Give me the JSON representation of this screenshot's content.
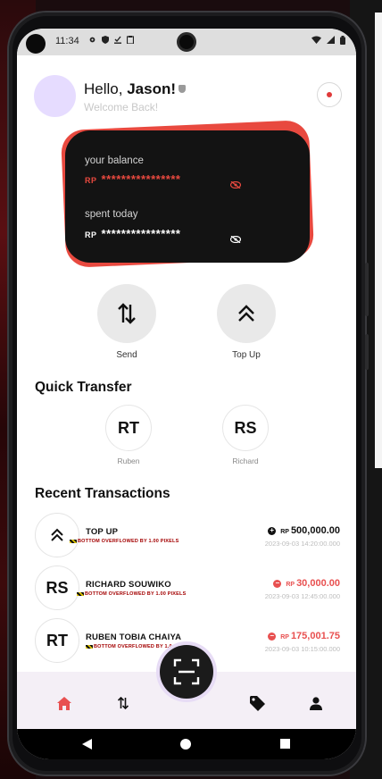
{
  "status": {
    "time": "11:34"
  },
  "header": {
    "greeting": "Hello,",
    "name": "Jason!",
    "subtitle": "Welcome Back!"
  },
  "balance_card": {
    "balance_label": "your balance",
    "balance_currency": "RP",
    "balance_value": "****************",
    "spent_label": "spent today",
    "spent_currency": "RP",
    "spent_value": "****************",
    "back_color": "#e8493f",
    "card_color": "#131313"
  },
  "actions": [
    {
      "label": "Send",
      "icon": "swap-vertical-icon"
    },
    {
      "label": "Top Up",
      "icon": "double-chevron-up-icon"
    }
  ],
  "quick_transfer": {
    "title": "Quick Transfer",
    "contacts": [
      {
        "initials": "RT",
        "name": "Ruben"
      },
      {
        "initials": "RS",
        "name": "Richard"
      }
    ]
  },
  "recent_transactions": {
    "title": "Recent Transactions",
    "items": [
      {
        "icon": "double-chevron-up-icon",
        "name": "TOP UP",
        "error": "BOTTOM OVERFLOWED BY 1.00 PIXELS",
        "currency": "RP",
        "amount": "500,000.00",
        "date": "2023-09-03 14:20:00.000",
        "type": "credit"
      },
      {
        "initials": "RS",
        "name": "RICHARD SOUWIKO",
        "error": "BOTTOM OVERFLOWED BY 1.00 PIXELS",
        "currency": "RP",
        "amount": "30,000.00",
        "date": "2023-09-03 12:45:00.000",
        "type": "debit"
      },
      {
        "initials": "RT",
        "name": "RUBEN TOBIA CHAIYA",
        "error": "BOTTOM OVERFLOWED BY 1.0",
        "currency": "RP",
        "amount": "175,001.75",
        "date": "2023-09-03 10:15:00.000",
        "type": "debit"
      }
    ]
  },
  "colors": {
    "accent_red": "#e8493f",
    "credit": "#111111",
    "debit": "#e85050",
    "nav_background": "#f4eff6"
  },
  "bottom_nav": [
    "home-icon",
    "swap-vertical-icon",
    "scan-icon",
    "tag-icon",
    "person-icon"
  ]
}
